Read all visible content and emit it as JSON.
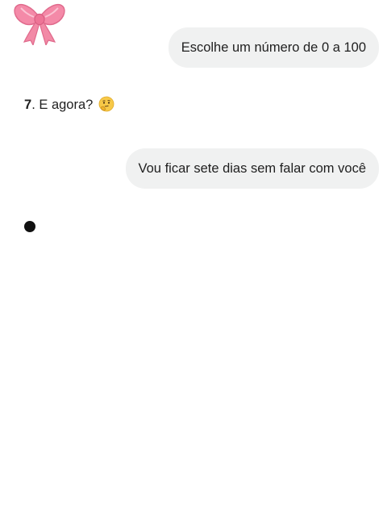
{
  "conversation": {
    "user_message_1": "Escolhe um número de 0 a 100",
    "assistant_number": "7",
    "assistant_text": ". E agora? ",
    "assistant_emoji": "thinking-face-icon",
    "user_message_2": "Vou ficar sete dias sem falar com você"
  },
  "decoration": {
    "sticker": "pink-bow-icon",
    "bow_color": "#f07a9c"
  },
  "status": {
    "typing_indicator": "typing-dot"
  }
}
